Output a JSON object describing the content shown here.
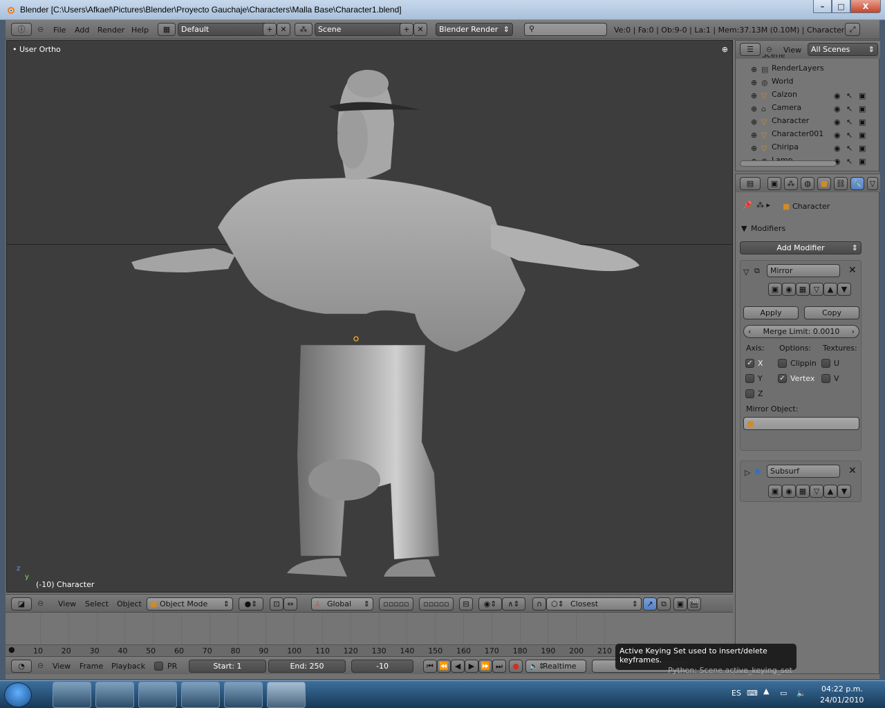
{
  "window": {
    "title": "Blender [C:\\Users\\Afkael\\Pictures\\Blender\\Proyecto Gauchaje\\Characters\\Malla Base\\Character1.blend]",
    "min": "–",
    "max": "□",
    "close": "X"
  },
  "info_header": {
    "menus": [
      "File",
      "Add",
      "Render",
      "Help"
    ],
    "screen_layout": "Default",
    "scene": "Scene",
    "render_engine": "Blender Render",
    "search_placeholder": "",
    "stats": "Ve:0 | Fa:0 | Ob:9-0 | La:1 | Mem:37.13M (0.10M) | Character"
  },
  "viewport": {
    "view_name": "User Ortho",
    "object_info": "(-10) Character",
    "axis_z": "z",
    "axis_y": "y"
  },
  "view3d_header": {
    "menus": [
      "View",
      "Select",
      "Object"
    ],
    "mode": "Object Mode",
    "orientation": "Global",
    "snap_target": "Closest"
  },
  "timeline": {
    "frames": [
      "10",
      "20",
      "30",
      "40",
      "50",
      "60",
      "70",
      "80",
      "90",
      "100",
      "110",
      "120",
      "130",
      "140",
      "150",
      "160",
      "170",
      "180",
      "190",
      "200",
      "210"
    ]
  },
  "timeline_header": {
    "menus": [
      "View",
      "Frame",
      "Playback"
    ],
    "pr_label": "PR",
    "start": "Start: 1",
    "end": "End: 250",
    "current": "-10",
    "sync": "Realtime"
  },
  "tooltip": {
    "text": "Active Keying Set used to insert/delete keyframes.",
    "python": "Python: Scene.active_keying_set"
  },
  "outliner": {
    "view_menu": "View",
    "filter": "All Scenes",
    "scene_label": "Scene",
    "items": [
      {
        "name": "RenderLayers",
        "icon": "renderlayers-icon"
      },
      {
        "name": "World",
        "icon": "world-icon"
      },
      {
        "name": "Calzon",
        "icon": "mesh-icon"
      },
      {
        "name": "Camera",
        "icon": "camera-icon"
      },
      {
        "name": "Character",
        "icon": "mesh-icon"
      },
      {
        "name": "Character001",
        "icon": "mesh-icon"
      },
      {
        "name": "Chiripa",
        "icon": "mesh-icon"
      },
      {
        "name": "Lamp",
        "icon": "lamp-icon"
      }
    ]
  },
  "properties": {
    "context_object": "Character",
    "modifiers_title": "Modifiers",
    "add_modifier": "Add Modifier",
    "mirror": {
      "name": "Mirror",
      "apply": "Apply",
      "copy": "Copy",
      "merge_limit": "Merge Limit: 0.0010",
      "axis_label": "Axis:",
      "options_label": "Options:",
      "textures_label": "Textures:",
      "x": "X",
      "y": "Y",
      "z": "Z",
      "clipping": "Clippin",
      "vertex": "Vertex",
      "u": "U",
      "v": "V",
      "x_checked": true,
      "vertex_checked": true,
      "mirror_object_label": "Mirror Object:"
    },
    "subsurf": {
      "name": "Subsurf"
    }
  },
  "taskbar": {
    "lang": "ES",
    "time": "04:22 p.m.",
    "date": "24/01/2010"
  },
  "colors": {
    "viewport_bg": "#3d3d3d",
    "panel_bg": "#757575",
    "accent_active": "#5680c2",
    "object_origin": "#e8a030"
  }
}
